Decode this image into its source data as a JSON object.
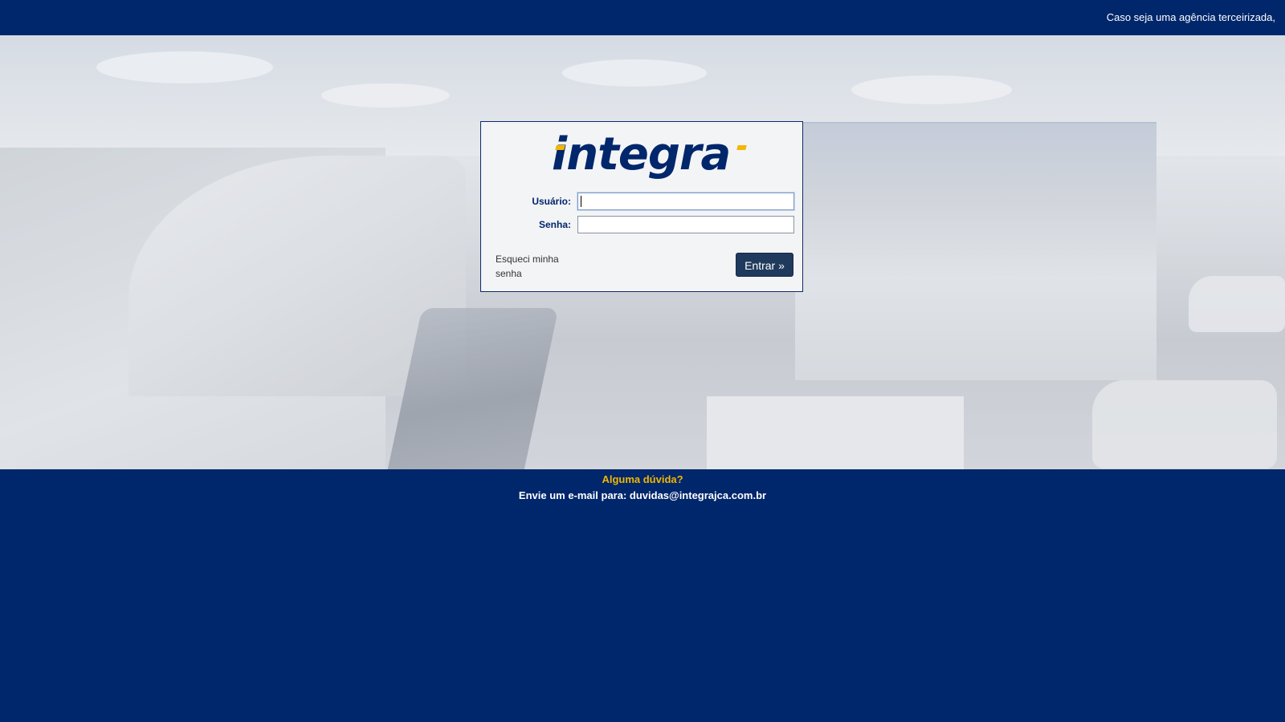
{
  "header": {
    "notice": "Caso seja uma agência terceirizada,"
  },
  "logo": {
    "text": "integra",
    "accent_color": "#f2b705",
    "brand_color": "#00266b"
  },
  "login": {
    "user_label": "Usuário:",
    "user_value": "",
    "password_label": "Senha:",
    "password_value": "",
    "forgot_link": "Esqueci minha senha",
    "submit_label": "Entrar »"
  },
  "footer": {
    "question": "Alguma dúvida?",
    "email_text": "Envie um e-mail para: duvidas@integrajca.com.br"
  },
  "colors": {
    "background": "#00266b",
    "button": "#1f3a5c",
    "question_text": "#f1b700"
  }
}
